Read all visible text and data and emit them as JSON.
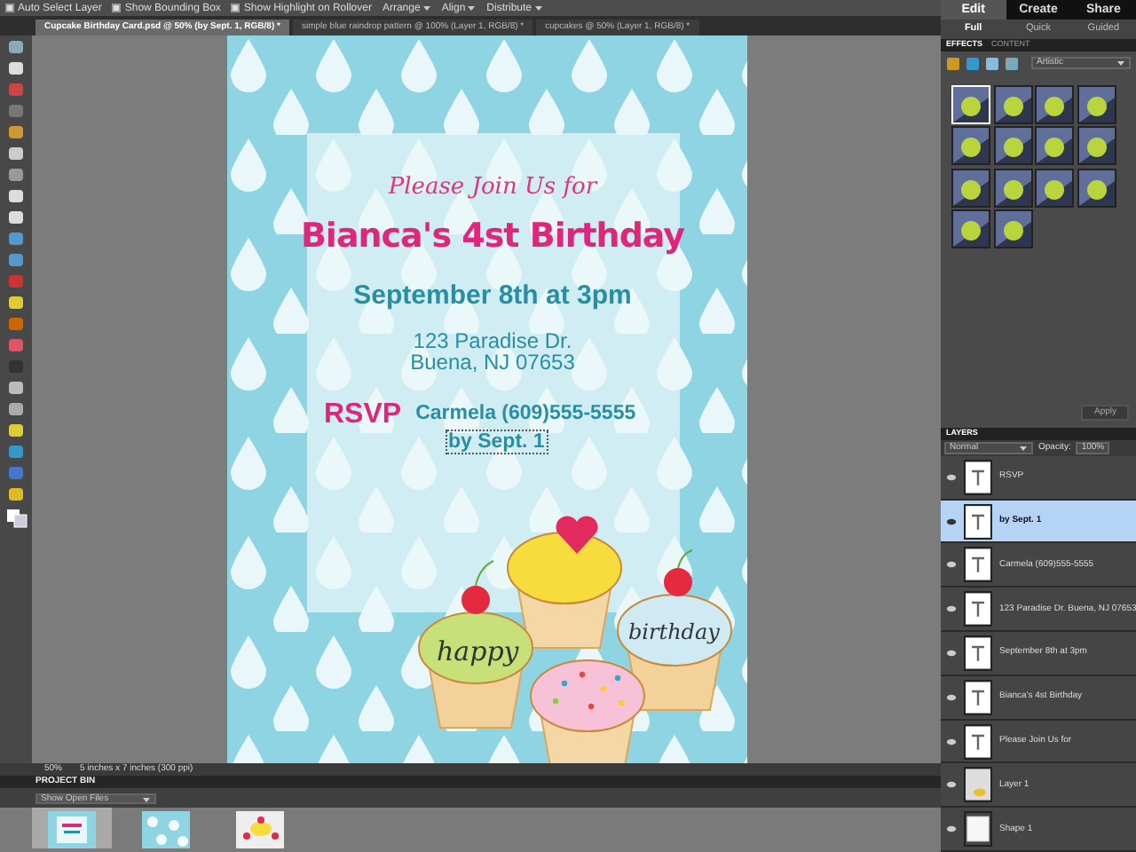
{
  "options_bar": {
    "checkboxes": [
      {
        "label": "Auto Select Layer",
        "checked": true
      },
      {
        "label": "Show Bounding Box",
        "checked": true
      },
      {
        "label": "Show Highlight on Rollover",
        "checked": true
      }
    ],
    "menus": [
      "Arrange",
      "Align",
      "Distribute"
    ]
  },
  "document_tabs": [
    {
      "label": "Cupcake Birthday Card.psd @ 50% (by Sept. 1, RGB/8) *",
      "selected": true
    },
    {
      "label": "simple blue raindrop pattern @ 100% (Layer 1, RGB/8) *",
      "selected": false
    },
    {
      "label": "cupcakes @ 50% (Layer 1, RGB/8) *",
      "selected": false
    }
  ],
  "invitation": {
    "heading": "Please Join Us for",
    "title": "Bianca's 4st Birthday",
    "date": "September 8th at 3pm",
    "address": [
      "123 Paradise Dr.",
      "Buena, NJ 07653"
    ],
    "rsvp_label": "RSVP",
    "rsvp_contact": "Carmela (609)555-5555",
    "rsvp_deadline": "by Sept. 1",
    "cupcake_words": [
      "happy",
      "birthday"
    ]
  },
  "status_bar": {
    "zoom": "50%",
    "document_size": "5 inches x 7 inches (300 ppi)"
  },
  "project_bin": {
    "title": "PROJECT BIN",
    "filter": "Show Open Files",
    "files": [
      {
        "kind": "invitation",
        "selected": true
      },
      {
        "kind": "pattern",
        "selected": false
      },
      {
        "kind": "cupcakes",
        "selected": false
      }
    ]
  },
  "mode_tabs": [
    {
      "label": "Edit",
      "selected": true
    },
    {
      "label": "Create",
      "selected": false
    },
    {
      "label": "Share",
      "selected": false
    }
  ],
  "edit_tabs": [
    {
      "label": "Full",
      "selected": true
    },
    {
      "label": "Quick",
      "selected": false
    },
    {
      "label": "Guided",
      "selected": false
    }
  ],
  "effects": {
    "tabs": [
      {
        "label": "EFFECTS",
        "selected": true
      },
      {
        "label": "CONTENT",
        "selected": false
      }
    ],
    "category": "Artistic",
    "thumbnails": [
      {
        "selected": true
      },
      {
        "selected": false
      },
      {
        "selected": false
      },
      {
        "selected": false
      },
      {
        "selected": false
      },
      {
        "selected": false
      },
      {
        "selected": false
      },
      {
        "selected": false
      },
      {
        "selected": false
      },
      {
        "selected": false
      },
      {
        "selected": false
      },
      {
        "selected": false
      },
      {
        "selected": false
      },
      {
        "selected": false
      }
    ],
    "apply_button": "Apply"
  },
  "layers": {
    "title": "LAYERS",
    "blend_mode": "Normal",
    "opacity_label": "Opacity:",
    "opacity": "100%",
    "items": [
      {
        "name": "RSVP",
        "kind": "text",
        "selected": false
      },
      {
        "name": "by Sept. 1",
        "kind": "text",
        "selected": true
      },
      {
        "name": "Carmela (609)555-5555",
        "kind": "text",
        "selected": false
      },
      {
        "name": "123 Paradise Dr. Buena, NJ 07653",
        "kind": "text",
        "selected": false
      },
      {
        "name": "September 8th at 3pm",
        "kind": "text",
        "selected": false
      },
      {
        "name": "Bianca's 4st Birthday",
        "kind": "text",
        "selected": false
      },
      {
        "name": "Please Join Us for",
        "kind": "text",
        "selected": false
      },
      {
        "name": "Layer 1",
        "kind": "image",
        "selected": false
      },
      {
        "name": "Shape 1",
        "kind": "shape",
        "selected": false
      }
    ]
  }
}
